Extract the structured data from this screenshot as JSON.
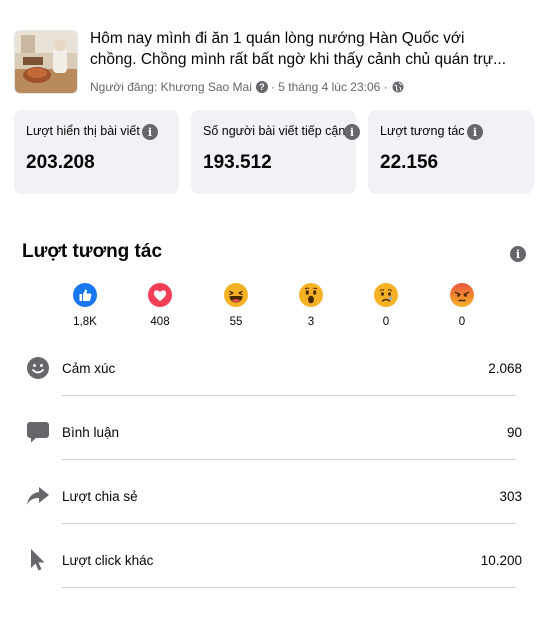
{
  "post": {
    "title_line1": "Hôm nay mình đi ăn 1 quán lòng nướng Hàn Quốc với",
    "title_line2": "chồng. Chồng mình rất bất ngờ khi thấy cảnh chủ quán trự...",
    "author_prefix": "Người đăng: Khương Sao Mai",
    "date": "· 5 tháng 4 lúc 23:06 ·"
  },
  "stats": [
    {
      "label": "Lượt hiển thị bài viết",
      "value": "203.208"
    },
    {
      "label": "Số người bài viết tiếp cận",
      "value": "193.512"
    },
    {
      "label": "Lượt tương tác",
      "value": "22.156"
    }
  ],
  "engagement": {
    "title": "Lượt tương tác",
    "reactions": [
      {
        "icon": "like-icon",
        "count": "1,8K"
      },
      {
        "icon": "love-icon",
        "count": "408"
      },
      {
        "icon": "haha-icon",
        "count": "55"
      },
      {
        "icon": "wow-icon",
        "count": "3"
      },
      {
        "icon": "sad-icon",
        "count": "0"
      },
      {
        "icon": "angry-icon",
        "count": "0"
      }
    ],
    "rows": [
      {
        "icon": "smiley-icon",
        "label": "Cảm xúc",
        "value": "2.068"
      },
      {
        "icon": "comment-icon",
        "label": "Bình luận",
        "value": "90"
      },
      {
        "icon": "share-icon",
        "label": "Lượt chia sẻ",
        "value": "303"
      },
      {
        "icon": "cursor-icon",
        "label": "Lượt click khác",
        "value": "10.200"
      }
    ]
  },
  "colors": {
    "card_bg": "#f0f2f5",
    "icon_gray": "#65676b",
    "like_blue": "#1877f2",
    "love_red": "#f33e58",
    "emoji_yellow": "#f7b125"
  }
}
